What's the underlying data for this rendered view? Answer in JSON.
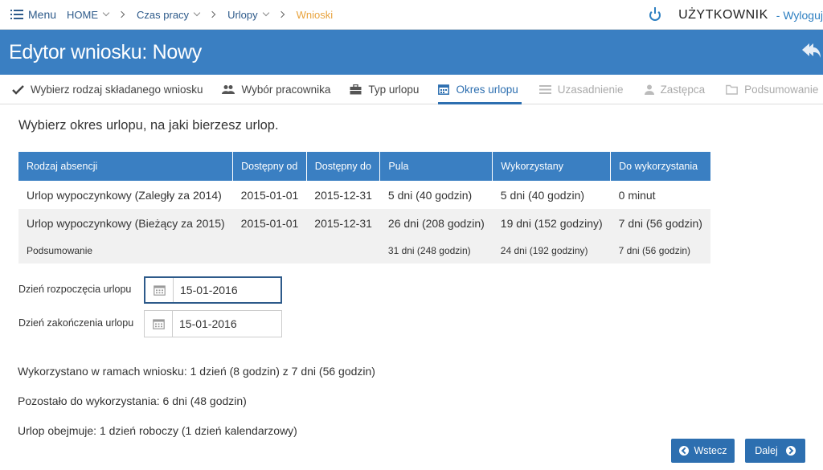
{
  "topbar": {
    "menu_label": "Menu",
    "breadcrumbs": [
      "HOME",
      "Czas pracy",
      "Urlopy",
      "Wnioski"
    ],
    "username": "UŻYTKOWNIK",
    "logout_label": "- Wyloguj"
  },
  "title": "Edytor wniosku: Nowy",
  "steps": [
    {
      "label": "Wybierz rodzaj składanego wniosku",
      "icon": "check-icon",
      "state": "done"
    },
    {
      "label": "Wybór pracownika",
      "icon": "users-icon",
      "state": "done"
    },
    {
      "label": "Typ urlopu",
      "icon": "briefcase-icon",
      "state": "done"
    },
    {
      "label": "Okres urlopu",
      "icon": "calendar-icon",
      "state": "active"
    },
    {
      "label": "Uzasadnienie",
      "icon": "list-icon",
      "state": "disabled"
    },
    {
      "label": "Zastępca",
      "icon": "user-icon",
      "state": "disabled"
    },
    {
      "label": "Podsumowanie",
      "icon": "folder-icon",
      "state": "disabled"
    }
  ],
  "prompt": "Wybierz okres urlopu, na jaki bierzesz urlop.",
  "table": {
    "headers": [
      "Rodzaj absencji",
      "Dostępny od",
      "Dostępny do",
      "Pula",
      "Wykorzystany",
      "Do wykorzystania"
    ],
    "rows": [
      [
        "Urlop wypoczynkowy (Zaległy za 2014)",
        "2015-01-01",
        "2015-12-31",
        "5 dni (40 godzin)",
        "5 dni (40 godzin)",
        "0 minut"
      ],
      [
        "Urlop wypoczynkowy (Bieżący za 2015)",
        "2015-01-01",
        "2015-12-31",
        "26 dni (208 godzin)",
        "19 dni (152 godziny)",
        "7 dni (56 godzin)"
      ]
    ],
    "summary": [
      "Podsumowanie",
      "",
      "",
      "31 dni (248 godzin)",
      "24 dni (192 godziny)",
      "7 dni (56 godzin)"
    ]
  },
  "start_date": {
    "label": "Dzień rozpoczęcia urlopu",
    "value": "15-01-2016"
  },
  "end_date": {
    "label": "Dzień zakończenia urlopu",
    "value": "15-01-2016"
  },
  "info": {
    "used": "Wykorzystano w ramach wniosku: 1 dzień (8 godzin) z 7 dni (56 godzin)",
    "remaining": "Pozostało do wykorzystania: 6 dni (48 godzin)",
    "covers": "Urlop obejmuje: 1 dzień roboczy (1 dzień kalendarzowy)"
  },
  "buttons": {
    "back": "Wstecz",
    "next": "Dalej"
  },
  "colors": {
    "primary": "#3a7fc2",
    "accent_breadcrumb": "#e8a33d",
    "button": "#2d6fb0"
  }
}
